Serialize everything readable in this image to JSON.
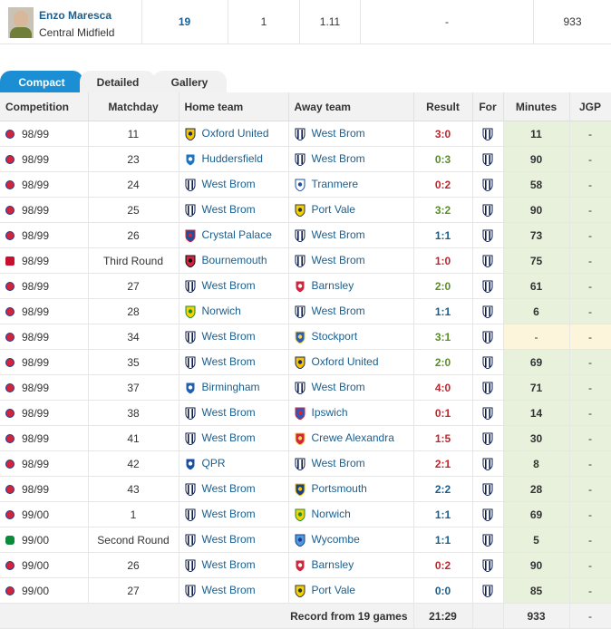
{
  "player": {
    "name": "Enzo Maresca",
    "position": "Central Midfield",
    "stat1": "19",
    "stat2": "1",
    "stat3": "1.11",
    "stat4": "-",
    "stat5": "933"
  },
  "tabs": [
    "Compact",
    "Detailed",
    "Gallery"
  ],
  "headers": {
    "competition": "Competition",
    "matchday": "Matchday",
    "home": "Home team",
    "away": "Away team",
    "result": "Result",
    "for": "For",
    "minutes": "Minutes",
    "jgp": "JGP"
  },
  "rows": [
    {
      "comp": "league",
      "season": "98/99",
      "matchday": "11",
      "home": "Oxford United",
      "home_crest": "oxford",
      "away": "West Brom",
      "away_crest": "wba",
      "result": "3:0",
      "rc": "loss",
      "minutes": "11",
      "jgp": "-"
    },
    {
      "comp": "league",
      "season": "98/99",
      "matchday": "23",
      "home": "Huddersfield",
      "home_crest": "huddersfield",
      "away": "West Brom",
      "away_crest": "wba",
      "result": "0:3",
      "rc": "win",
      "minutes": "90",
      "jgp": "-"
    },
    {
      "comp": "league",
      "season": "98/99",
      "matchday": "24",
      "home": "West Brom",
      "home_crest": "wba",
      "away": "Tranmere",
      "away_crest": "tranmere",
      "result": "0:2",
      "rc": "loss",
      "minutes": "58",
      "jgp": "-"
    },
    {
      "comp": "league",
      "season": "98/99",
      "matchday": "25",
      "home": "West Brom",
      "home_crest": "wba",
      "away": "Port Vale",
      "away_crest": "portvale",
      "result": "3:2",
      "rc": "win",
      "minutes": "90",
      "jgp": "-"
    },
    {
      "comp": "league",
      "season": "98/99",
      "matchday": "26",
      "home": "Crystal Palace",
      "home_crest": "palace",
      "away": "West Brom",
      "away_crest": "wba",
      "result": "1:1",
      "rc": "draw",
      "minutes": "73",
      "jgp": "-"
    },
    {
      "comp": "cup",
      "season": "98/99",
      "matchday": "Third Round",
      "home": "Bournemouth",
      "home_crest": "bournemouth",
      "away": "West Brom",
      "away_crest": "wba",
      "result": "1:0",
      "rc": "loss",
      "minutes": "75",
      "jgp": "-"
    },
    {
      "comp": "league",
      "season": "98/99",
      "matchday": "27",
      "home": "West Brom",
      "home_crest": "wba",
      "away": "Barnsley",
      "away_crest": "barnsley",
      "result": "2:0",
      "rc": "win",
      "minutes": "61",
      "jgp": "-"
    },
    {
      "comp": "league",
      "season": "98/99",
      "matchday": "28",
      "home": "Norwich",
      "home_crest": "norwich",
      "away": "West Brom",
      "away_crest": "wba",
      "result": "1:1",
      "rc": "draw",
      "minutes": "6",
      "jgp": "-"
    },
    {
      "comp": "league",
      "season": "98/99",
      "matchday": "34",
      "home": "West Brom",
      "home_crest": "wba",
      "away": "Stockport",
      "away_crest": "stockport",
      "result": "3:1",
      "rc": "win",
      "minutes": "-",
      "jgp": "-",
      "dnp": true
    },
    {
      "comp": "league",
      "season": "98/99",
      "matchday": "35",
      "home": "West Brom",
      "home_crest": "wba",
      "away": "Oxford United",
      "away_crest": "oxford",
      "result": "2:0",
      "rc": "win",
      "minutes": "69",
      "jgp": "-"
    },
    {
      "comp": "league",
      "season": "98/99",
      "matchday": "37",
      "home": "Birmingham",
      "home_crest": "birmingham",
      "away": "West Brom",
      "away_crest": "wba",
      "result": "4:0",
      "rc": "loss",
      "minutes": "71",
      "jgp": "-"
    },
    {
      "comp": "league",
      "season": "98/99",
      "matchday": "38",
      "home": "West Brom",
      "home_crest": "wba",
      "away": "Ipswich",
      "away_crest": "ipswich",
      "result": "0:1",
      "rc": "loss",
      "minutes": "14",
      "jgp": "-"
    },
    {
      "comp": "league",
      "season": "98/99",
      "matchday": "41",
      "home": "West Brom",
      "home_crest": "wba",
      "away": "Crewe Alexandra",
      "away_crest": "crewe",
      "result": "1:5",
      "rc": "loss",
      "minutes": "30",
      "jgp": "-"
    },
    {
      "comp": "league",
      "season": "98/99",
      "matchday": "42",
      "home": "QPR",
      "home_crest": "qpr",
      "away": "West Brom",
      "away_crest": "wba",
      "result": "2:1",
      "rc": "loss",
      "minutes": "8",
      "jgp": "-"
    },
    {
      "comp": "league",
      "season": "98/99",
      "matchday": "43",
      "home": "West Brom",
      "home_crest": "wba",
      "away": "Portsmouth",
      "away_crest": "portsmouth",
      "result": "2:2",
      "rc": "draw",
      "minutes": "28",
      "jgp": "-"
    },
    {
      "comp": "league",
      "season": "99/00",
      "matchday": "1",
      "home": "West Brom",
      "home_crest": "wba",
      "away": "Norwich",
      "away_crest": "norwich",
      "result": "1:1",
      "rc": "draw",
      "minutes": "69",
      "jgp": "-"
    },
    {
      "comp": "lc",
      "season": "99/00",
      "matchday": "Second Round",
      "home": "West Brom",
      "home_crest": "wba",
      "away": "Wycombe",
      "away_crest": "wycombe",
      "result": "1:1",
      "rc": "draw",
      "minutes": "5",
      "jgp": "-"
    },
    {
      "comp": "league",
      "season": "99/00",
      "matchday": "26",
      "home": "West Brom",
      "home_crest": "wba",
      "away": "Barnsley",
      "away_crest": "barnsley",
      "result": "0:2",
      "rc": "loss",
      "minutes": "90",
      "jgp": "-"
    },
    {
      "comp": "league",
      "season": "99/00",
      "matchday": "27",
      "home": "West Brom",
      "home_crest": "wba",
      "away": "Port Vale",
      "away_crest": "portvale",
      "result": "0:0",
      "rc": "draw",
      "minutes": "85",
      "jgp": "-"
    }
  ],
  "footer": {
    "label": "Record from 19 games",
    "result": "21:29",
    "minutes": "933",
    "jgp": "-"
  },
  "colors": {
    "accent": "#1b8ed4",
    "link": "#1a5f8f",
    "loss": "#c0262d",
    "win": "#5b8e2a",
    "draw": "#1a5f8f",
    "minutes_bg": "#e8f1dc"
  }
}
